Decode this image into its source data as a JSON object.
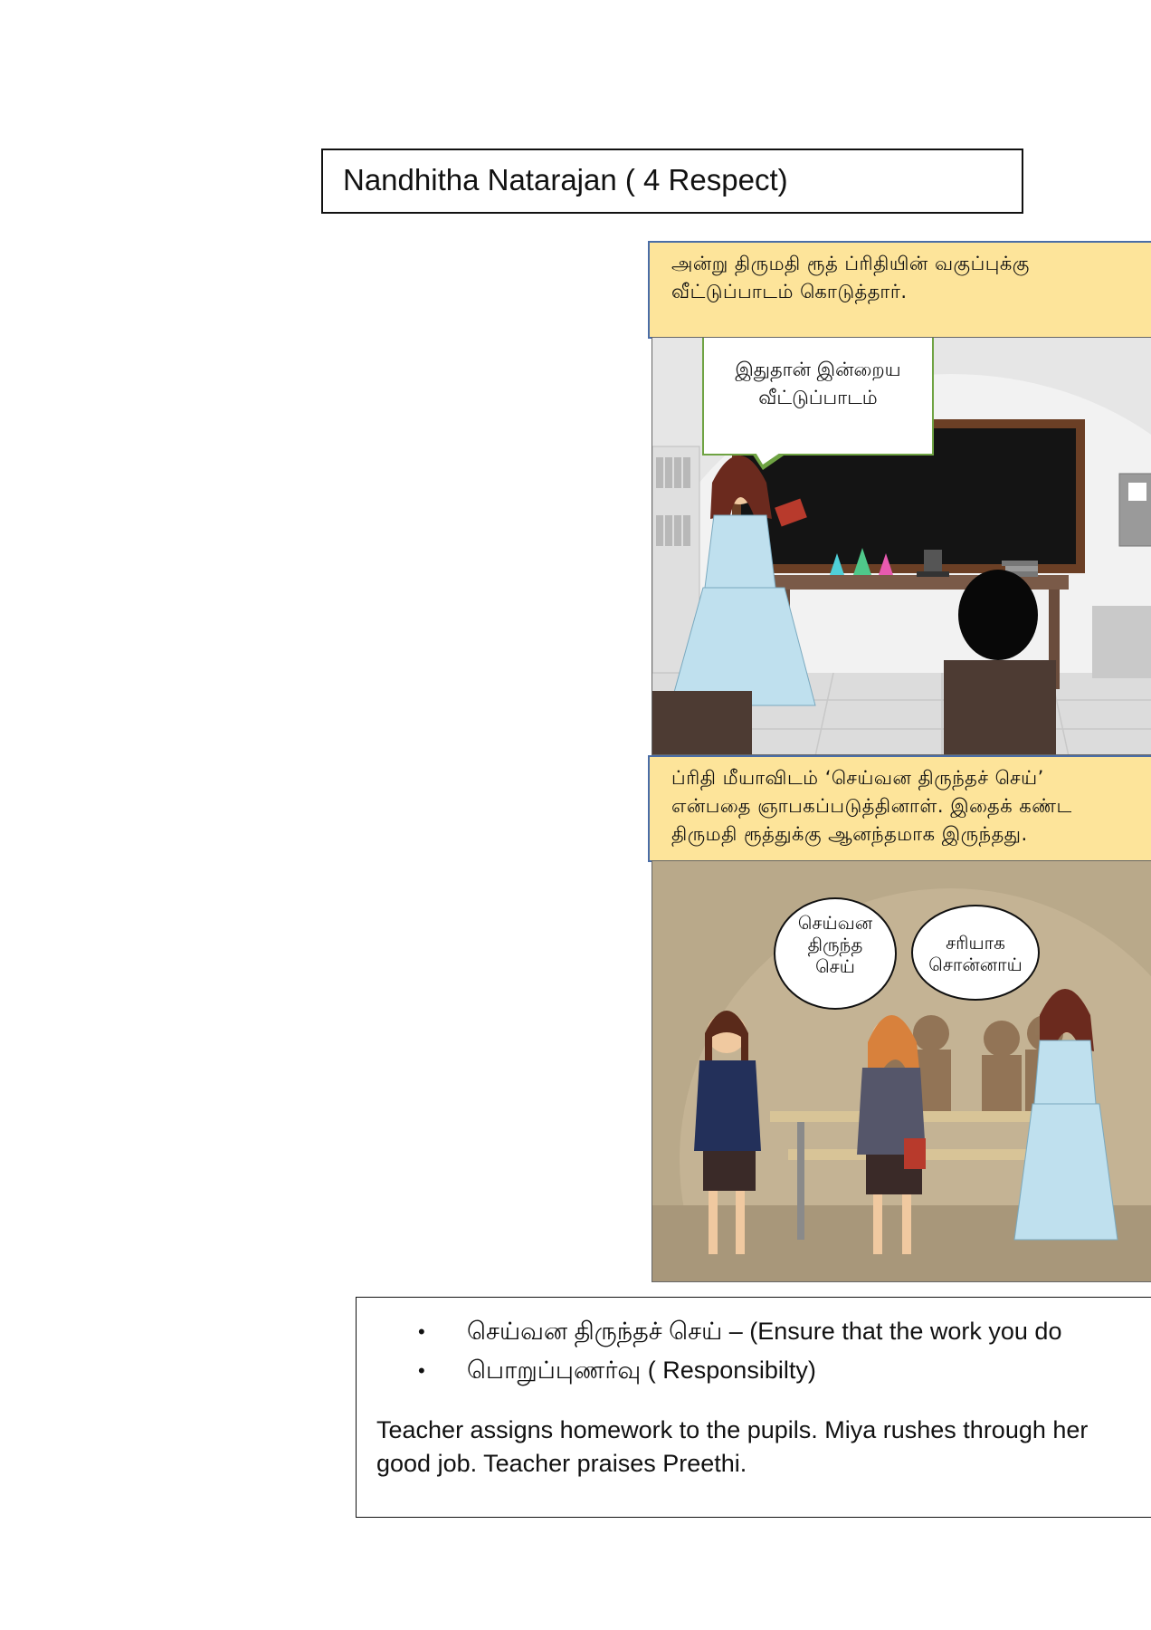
{
  "title": "Nandhitha Natarajan ( 4 Respect)",
  "panel1": {
    "caption": [
      "அன்று திருமதி ரூத் ப்ரிதியின் வகுப்புக்கு",
      "வீட்டுப்பாடம் கொடுத்தார்."
    ],
    "speech": [
      "இதுதான் இன்றைய",
      "வீட்டுப்பாடம்"
    ]
  },
  "panel2": {
    "caption": [
      "ப்ரிதி மீயாவிடம் ‘செய்வன திருந்தச் செய்’",
      "என்பதை ஞாபகப்படுத்தினாள். இதைக் கண்ட",
      "திருமதி ரூத்துக்கு ஆனந்தமாக இருந்தது."
    ],
    "bubble_left": [
      "செய்வன",
      "திருந்த",
      "செய்"
    ],
    "bubble_right": [
      "சரியாக",
      "சொன்னாய்"
    ]
  },
  "notes": {
    "bullets": [
      "செய்வன   திருந்தச்   செய் – (Ensure that the work you do",
      "பொறுப்புணர்வு  ( Responsibilty)"
    ],
    "summary": [
      "Teacher assigns homework to the pupils. Miya rushes through her",
      "good job. Teacher praises Preethi."
    ]
  },
  "colors": {
    "caption_bg": "#fde49a",
    "caption_border": "#4a6da7",
    "speech_border": "#6fa343"
  }
}
